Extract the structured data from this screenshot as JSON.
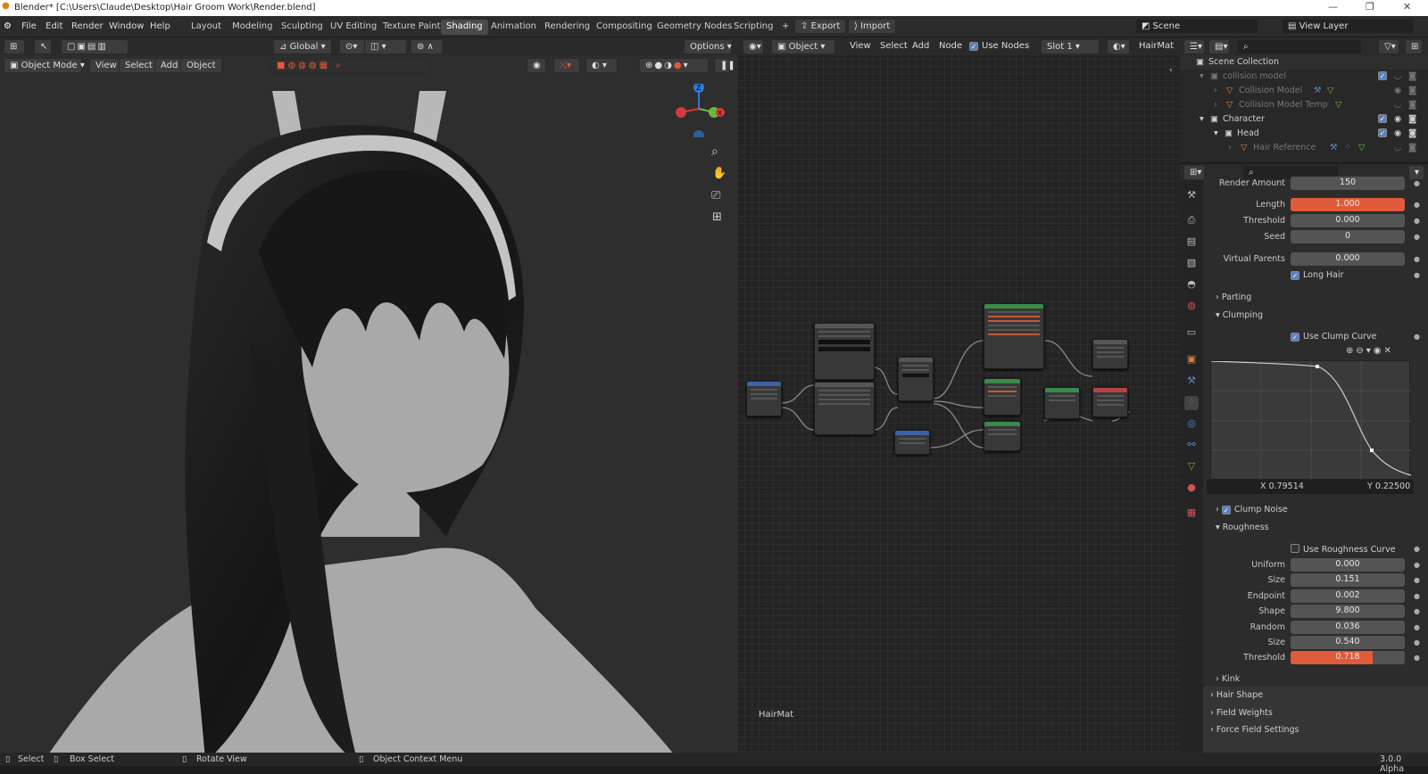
{
  "window": {
    "title": "Blender* [C:\\Users\\Claude\\Desktop\\Hair Groom Work\\Render.blend]",
    "version": "3.0.0 Alpha"
  },
  "menu": [
    "File",
    "Edit",
    "Render",
    "Window",
    "Help"
  ],
  "workspaces": [
    "Layout",
    "Modeling",
    "Sculpting",
    "UV Editing",
    "Texture Paint",
    "Shading",
    "Animation",
    "Rendering",
    "Compositing",
    "Geometry Nodes",
    "Scripting"
  ],
  "active_workspace": "Shading",
  "topbar": {
    "export": "Export",
    "import": "Import",
    "scene": "Scene",
    "view_layer": "View Layer"
  },
  "viewport": {
    "orientation": "Global",
    "options": "Options",
    "mode": "Object Mode",
    "menus": [
      "View",
      "Select",
      "Add",
      "Object"
    ]
  },
  "node_editor": {
    "type": "Object",
    "menus": [
      "View",
      "Select",
      "Add",
      "Node"
    ],
    "use_nodes": "Use Nodes",
    "slot": "Slot 1",
    "material": "HairMat",
    "material_label": "HairMat"
  },
  "outliner": {
    "root": "Scene Collection",
    "items": [
      {
        "name": "collision model",
        "dim": true,
        "indent": 1
      },
      {
        "name": "Collision Model",
        "dim": true,
        "indent": 2
      },
      {
        "name": "Collision Model Temp",
        "dim": true,
        "indent": 2
      },
      {
        "name": "Character",
        "dim": false,
        "indent": 1
      },
      {
        "name": "Head",
        "dim": false,
        "indent": 2
      },
      {
        "name": "Hair Reference",
        "dim": true,
        "indent": 3
      }
    ]
  },
  "properties": {
    "render_amount": {
      "label": "Render Amount",
      "value": "150"
    },
    "length": {
      "label": "Length",
      "value": "1.000"
    },
    "threshold": {
      "label": "Threshold",
      "value": "0.000"
    },
    "seed": {
      "label": "Seed",
      "value": "0"
    },
    "virtual_parents": {
      "label": "Virtual Parents",
      "value": "0.000"
    },
    "long_hair": "Long Hair",
    "parting": "Parting",
    "clumping": "Clumping",
    "use_clump_curve": "Use Clump Curve",
    "curve_x": "X 0.79514",
    "curve_y": "Y 0.22500",
    "clump_noise": "Clump Noise",
    "roughness": "Roughness",
    "use_roughness_curve": "Use Roughness Curve",
    "uniform": {
      "label": "Uniform",
      "value": "0.000"
    },
    "size1": {
      "label": "Size",
      "value": "0.151"
    },
    "endpoint": {
      "label": "Endpoint",
      "value": "0.002"
    },
    "shape": {
      "label": "Shape",
      "value": "9.800"
    },
    "random": {
      "label": "Random",
      "value": "0.036"
    },
    "size2": {
      "label": "Size",
      "value": "0.540"
    },
    "threshold2": {
      "label": "Threshold",
      "value": "0.718"
    },
    "kink": "Kink",
    "hair_shape": "Hair Shape",
    "field_weights": "Field Weights",
    "force_field_settings": "Force Field Settings"
  },
  "statusbar": {
    "select": "Select",
    "box_select": "Box Select",
    "rotate": "Rotate View",
    "context": "Object Context Menu"
  },
  "colors": {
    "accent": "#e05a3c",
    "active_tab": "#4a4a4a",
    "checkbox": "#5680c2"
  }
}
